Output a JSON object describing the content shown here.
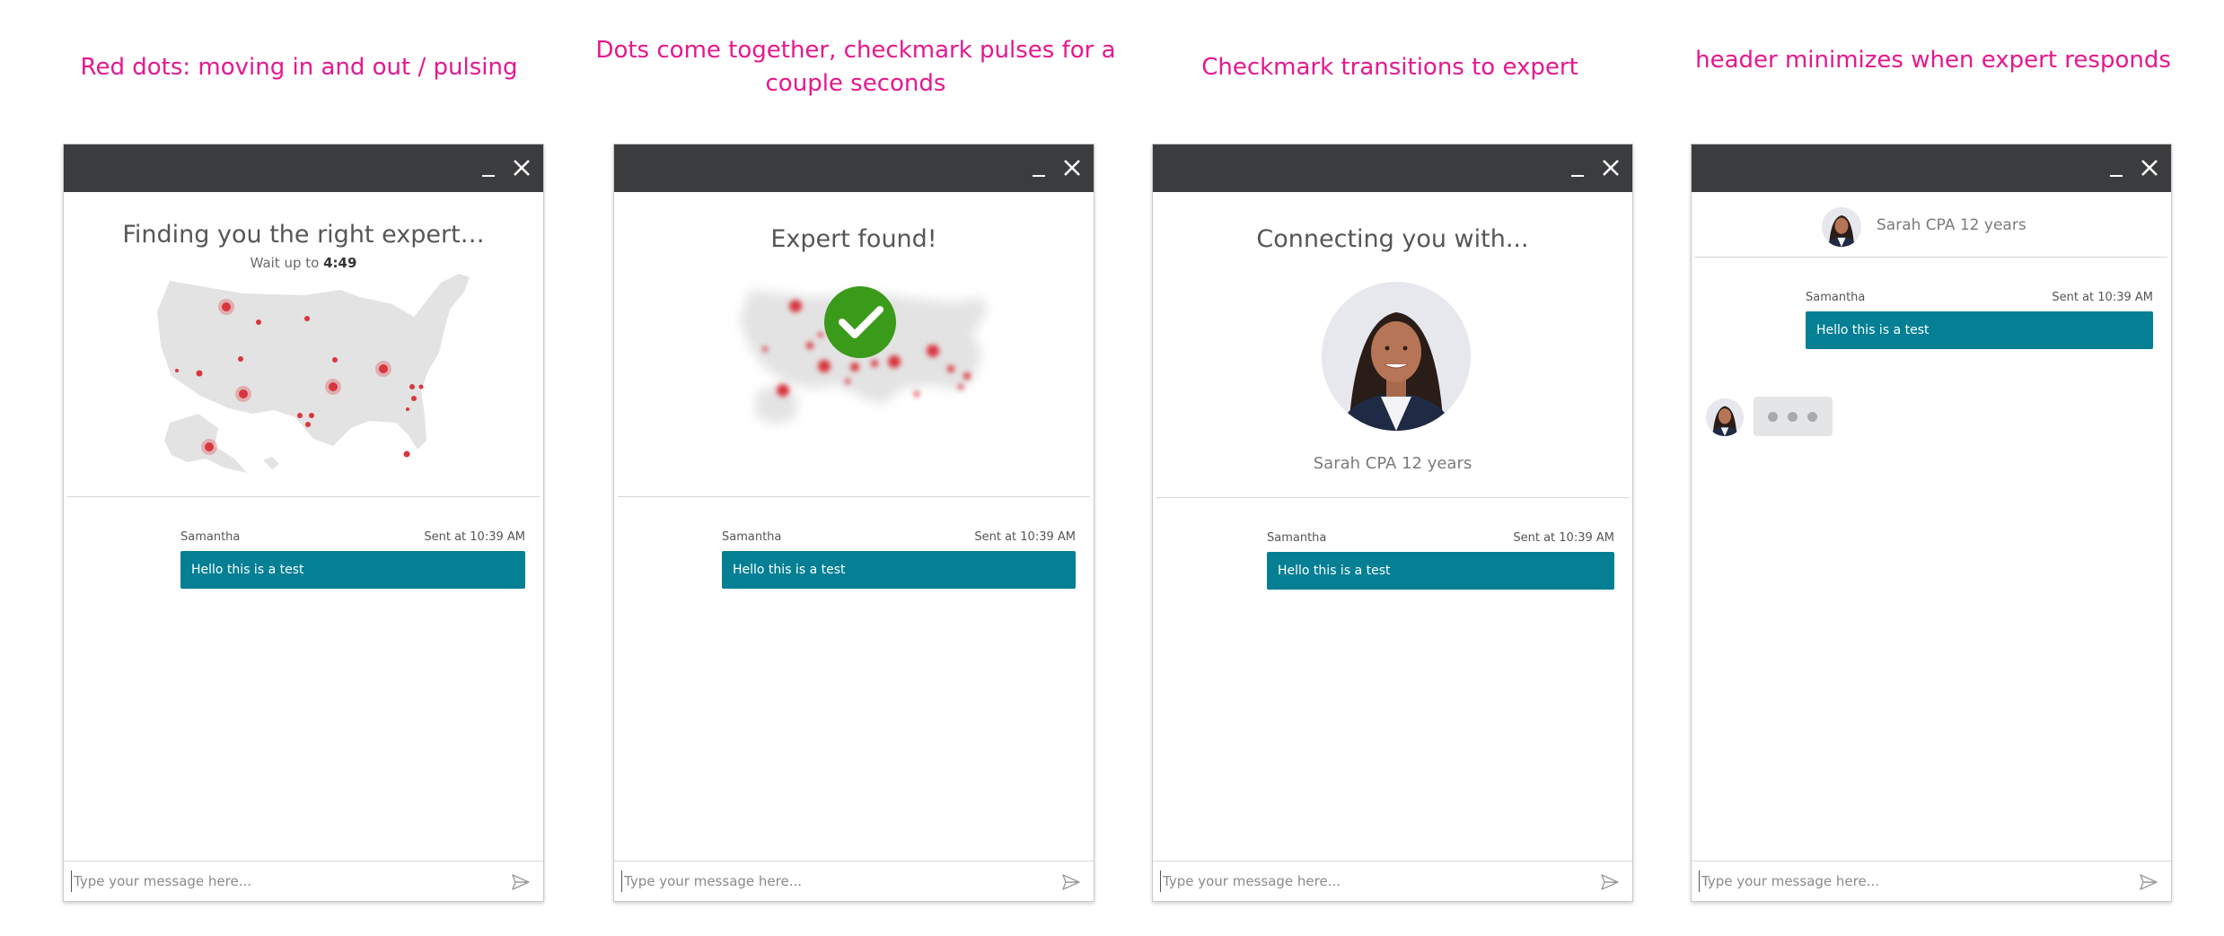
{
  "captions": [
    "Red dots: moving in and out / pulsing",
    "Dots come together, checkmark pulses for a couple seconds",
    "Checkmark transitions to expert",
    "header minimizes when expert responds"
  ],
  "panel1": {
    "title": "Finding you the right expert…",
    "wait_prefix": "Wait up to",
    "wait_time": "4:49"
  },
  "panel2": {
    "title": "Expert found!"
  },
  "panel3": {
    "title": "Connecting you with...",
    "expert_label": "Sarah CPA 12 years"
  },
  "panel4": {
    "expert_label": "Sarah CPA 12 years"
  },
  "message": {
    "sender": "Samantha",
    "time": "Sent at 10:39 AM",
    "text": "Hello this is a test"
  },
  "input": {
    "placeholder": "Type your message here..."
  },
  "icons": {
    "minimize": "minimize-icon",
    "close": "close-icon",
    "send": "send-icon",
    "map": "us-map-icon",
    "checkmark": "checkmark-icon",
    "typing": "typing-indicator-icon"
  },
  "colors": {
    "caption": "#e6178e",
    "titlebar": "#3b3c3e",
    "bubble": "#047f94",
    "dot": "#d9363e",
    "check": "#3a9a1a",
    "map": "#e3e3e3"
  }
}
